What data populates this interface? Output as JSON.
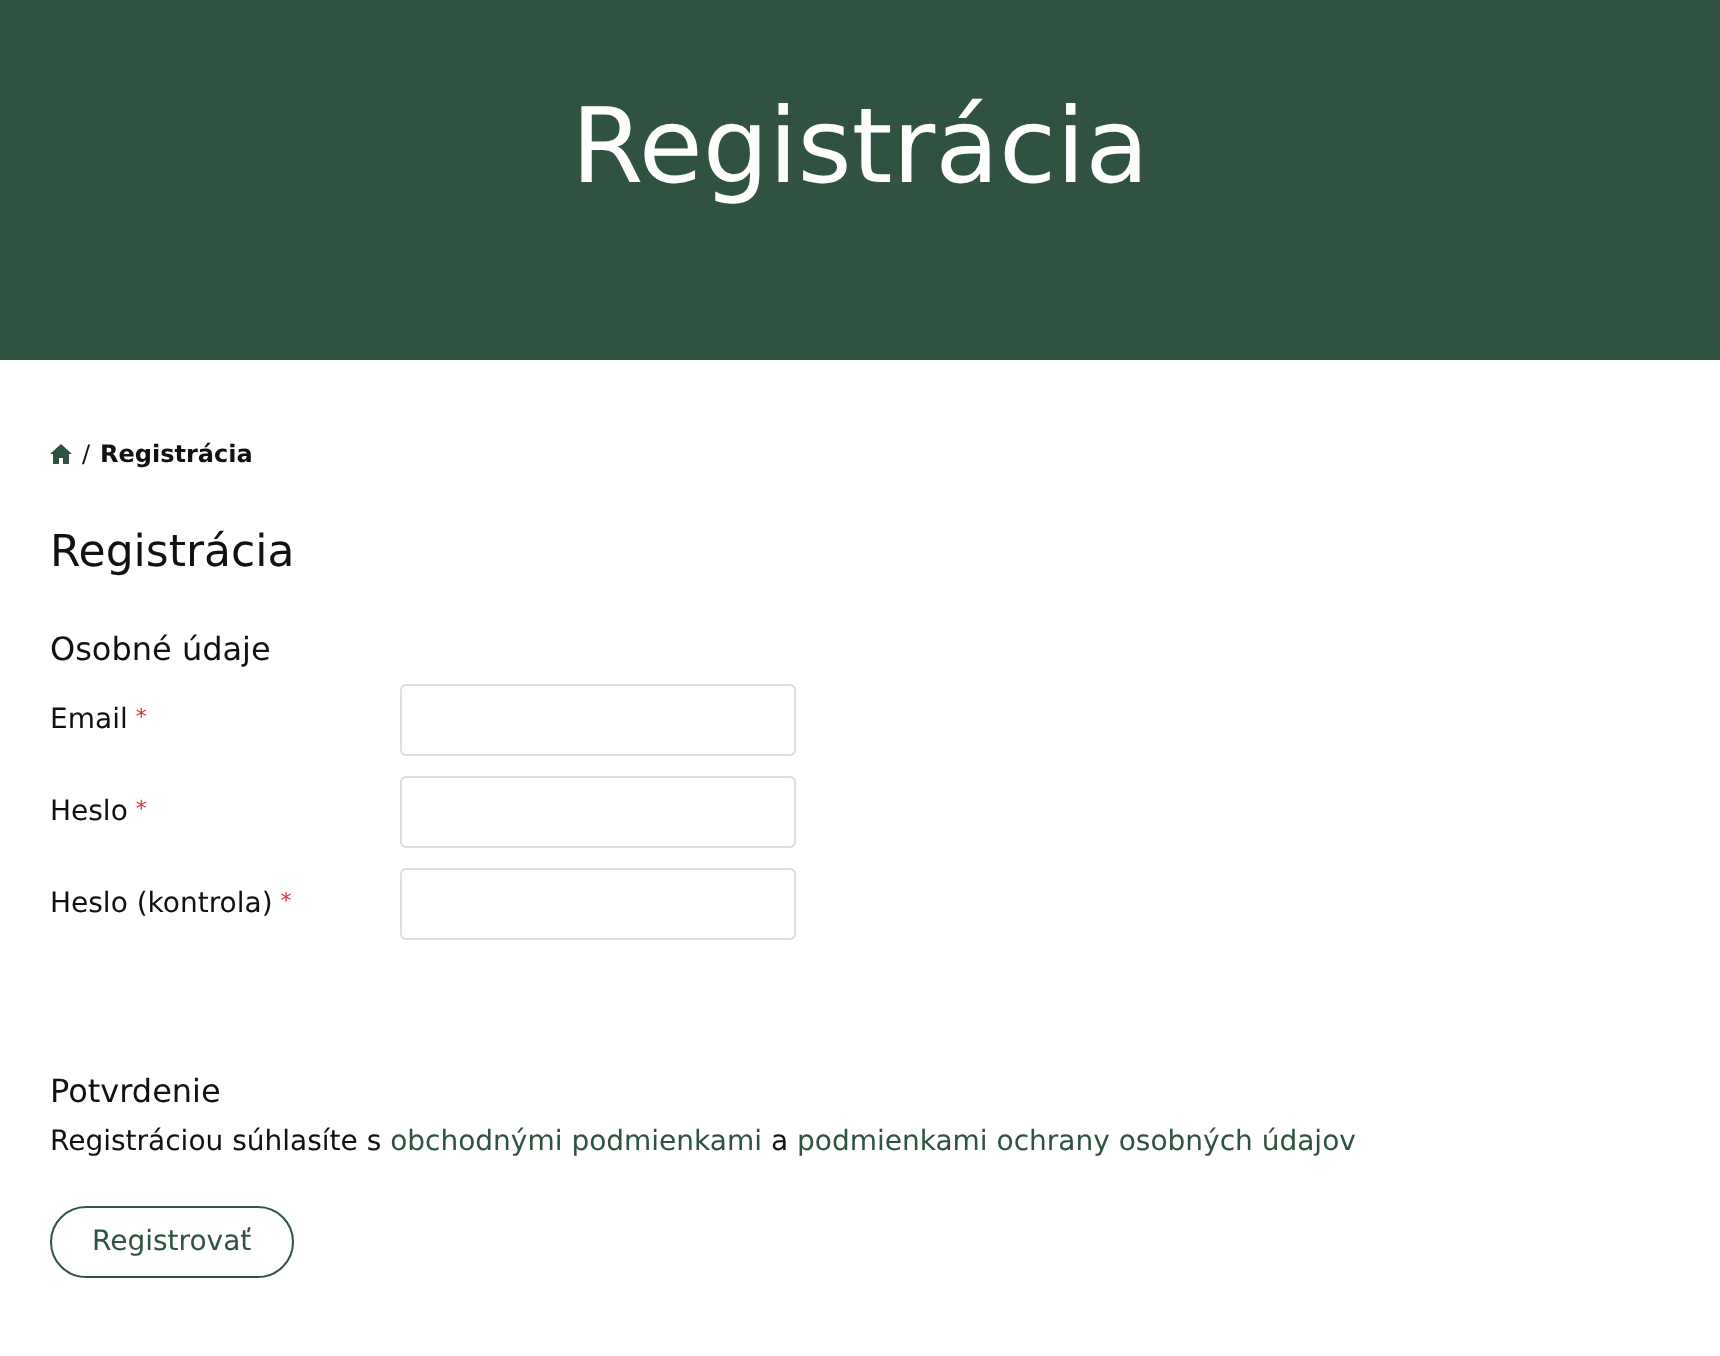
{
  "hero": {
    "title": "Registrácia"
  },
  "breadcrumb": {
    "current": "Registrácia",
    "separator": "/"
  },
  "page_title": "Registrácia",
  "personal_section": {
    "title": "Osobné údaje",
    "fields": [
      {
        "label": "Email",
        "required_mark": "*"
      },
      {
        "label": "Heslo",
        "required_mark": "*"
      },
      {
        "label": "Heslo (kontrola)",
        "required_mark": "*"
      }
    ]
  },
  "confirmation": {
    "title": "Potvrdenie",
    "sentence": [
      {
        "kind": "text",
        "text": "Registráciou súhlasíte s "
      },
      {
        "kind": "link",
        "text": "obchodnými podmienkami"
      },
      {
        "kind": "text",
        "text": " a "
      },
      {
        "kind": "link",
        "text": "podmienkami ochrany osobných údajov"
      }
    ]
  },
  "submit_button": "Registrovať"
}
